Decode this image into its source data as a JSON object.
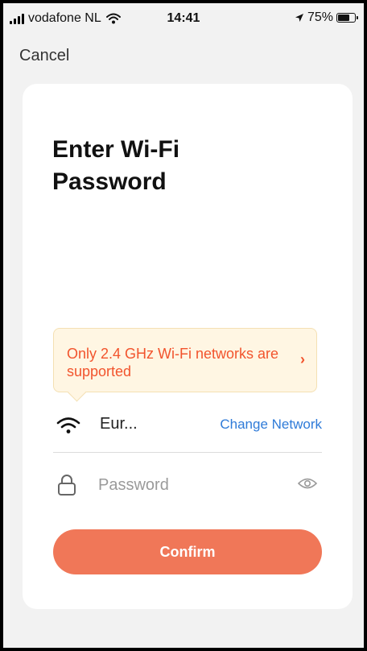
{
  "status_bar": {
    "carrier": "vodafone NL",
    "time": "14:41",
    "battery_percent": "75%",
    "battery_level": 0.75,
    "icons": [
      "signal-icon",
      "wifi-icon",
      "location-arrow-icon",
      "battery-icon"
    ]
  },
  "nav": {
    "cancel_label": "Cancel"
  },
  "card": {
    "title": "Enter Wi-Fi Password",
    "notice": {
      "text": "Only 2.4 GHz Wi-Fi networks are supported",
      "icon": "chevron-right-icon"
    },
    "network": {
      "icon": "wifi-icon",
      "name": "Eur...",
      "change_label": "Change Network"
    },
    "password": {
      "icon": "lock-icon",
      "value": "",
      "placeholder": "Password",
      "toggle_icon": "eye-icon"
    },
    "confirm_label": "Confirm"
  },
  "colors": {
    "accent": "#f07758",
    "notice_text": "#f2542d",
    "notice_bg": "#fff6e3",
    "link": "#2f7bd8"
  }
}
